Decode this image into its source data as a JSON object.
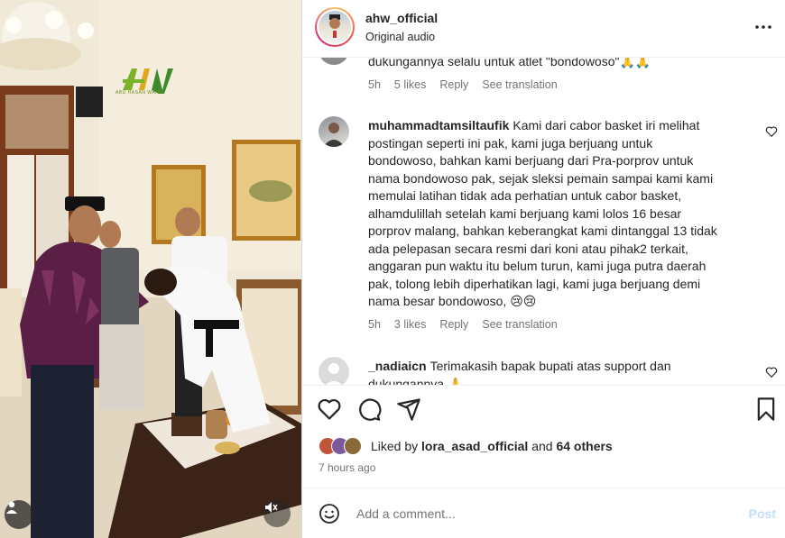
{
  "post": {
    "username": "ahw_official",
    "audio": "Original audio",
    "media_watermark": "AHW",
    "media_watermark_sub": "ABU HASAN WAHID"
  },
  "comments": [
    {
      "text": "dukungannya selalu untuk atlet \"bondowoso\"🙏🙏",
      "time": "5h",
      "likes": "5 likes",
      "reply": "Reply",
      "translate": "See translation"
    },
    {
      "username": "muhammadtamsiltaufik",
      "lines": [
        "Kami dari cabor basket iri melihat",
        "postingan seperti ini pak, kami juga berjuang untuk",
        "bondowoso, bahkan kami berjuang dari Pra-porprov untuk",
        "nama bondowoso pak, sejak sleksi pemain sampai kami kami",
        "memulai latihan tidak ada perhatian untuk cabor basket,",
        "alhamdulillah setelah kami berjuang kami lolos 16 besar",
        "porprov malang, bahkan keberangkat kami dintanggal 13 tidak",
        "ada pelepasan secara resmi dari koni atau pihak2 terkait,",
        "anggaran pun waktu itu belum turun, kami juga putra daerah",
        "pak, tolong lebih diperhatikan lagi, kami juga berjuang demi",
        "nama besar bondowoso, 😢😢"
      ],
      "time": "5h",
      "likes": "3 likes",
      "reply": "Reply",
      "translate": "See translation"
    },
    {
      "username": "_nadiaicn",
      "lines": [
        "Terimakasih bapak bupati atas support dan",
        "dukungannya 🙏"
      ]
    }
  ],
  "actions": {
    "liked_prefix": "Liked by",
    "liked_user": "lora_asad_official",
    "liked_and": "and",
    "liked_others": "64 others",
    "time_ago": "7 hours ago"
  },
  "composer": {
    "placeholder": "Add a comment...",
    "post_label": "Post"
  },
  "colors": {
    "text": "#262626",
    "muted": "#737373",
    "post_disabled": "#c0dffd",
    "border": "#efefef"
  },
  "icons": [
    "more-icon",
    "heart-icon",
    "comment-icon",
    "share-icon",
    "bookmark-icon",
    "emoji-icon",
    "user-tag-icon",
    "mute-icon"
  ]
}
